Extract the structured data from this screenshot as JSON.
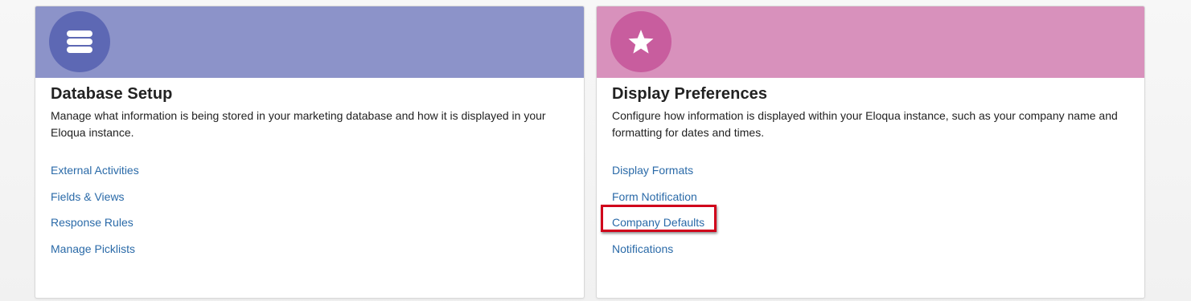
{
  "cards": [
    {
      "icon": "database-icon",
      "title": "Database Setup",
      "description": "Manage what information is being stored in your marketing database and how it is displayed in your Eloqua instance.",
      "links": [
        "External Activities",
        "Fields & Views",
        "Response Rules",
        "Manage Picklists"
      ],
      "header_color": "#8c93c9",
      "icon_color": "#5d68b4"
    },
    {
      "icon": "star-icon",
      "title": "Display Preferences",
      "description": "Configure how information is displayed within your Eloqua instance, such as your company name and formatting for dates and times.",
      "links": [
        "Display Formats",
        "Form Notification",
        "Company Defaults",
        "Notifications"
      ],
      "highlighted_link": "Company Defaults",
      "header_color": "#d891bc",
      "icon_color": "#c85d9e"
    }
  ],
  "colors": {
    "link": "#2a6aa8",
    "highlight": "#d0021b"
  }
}
